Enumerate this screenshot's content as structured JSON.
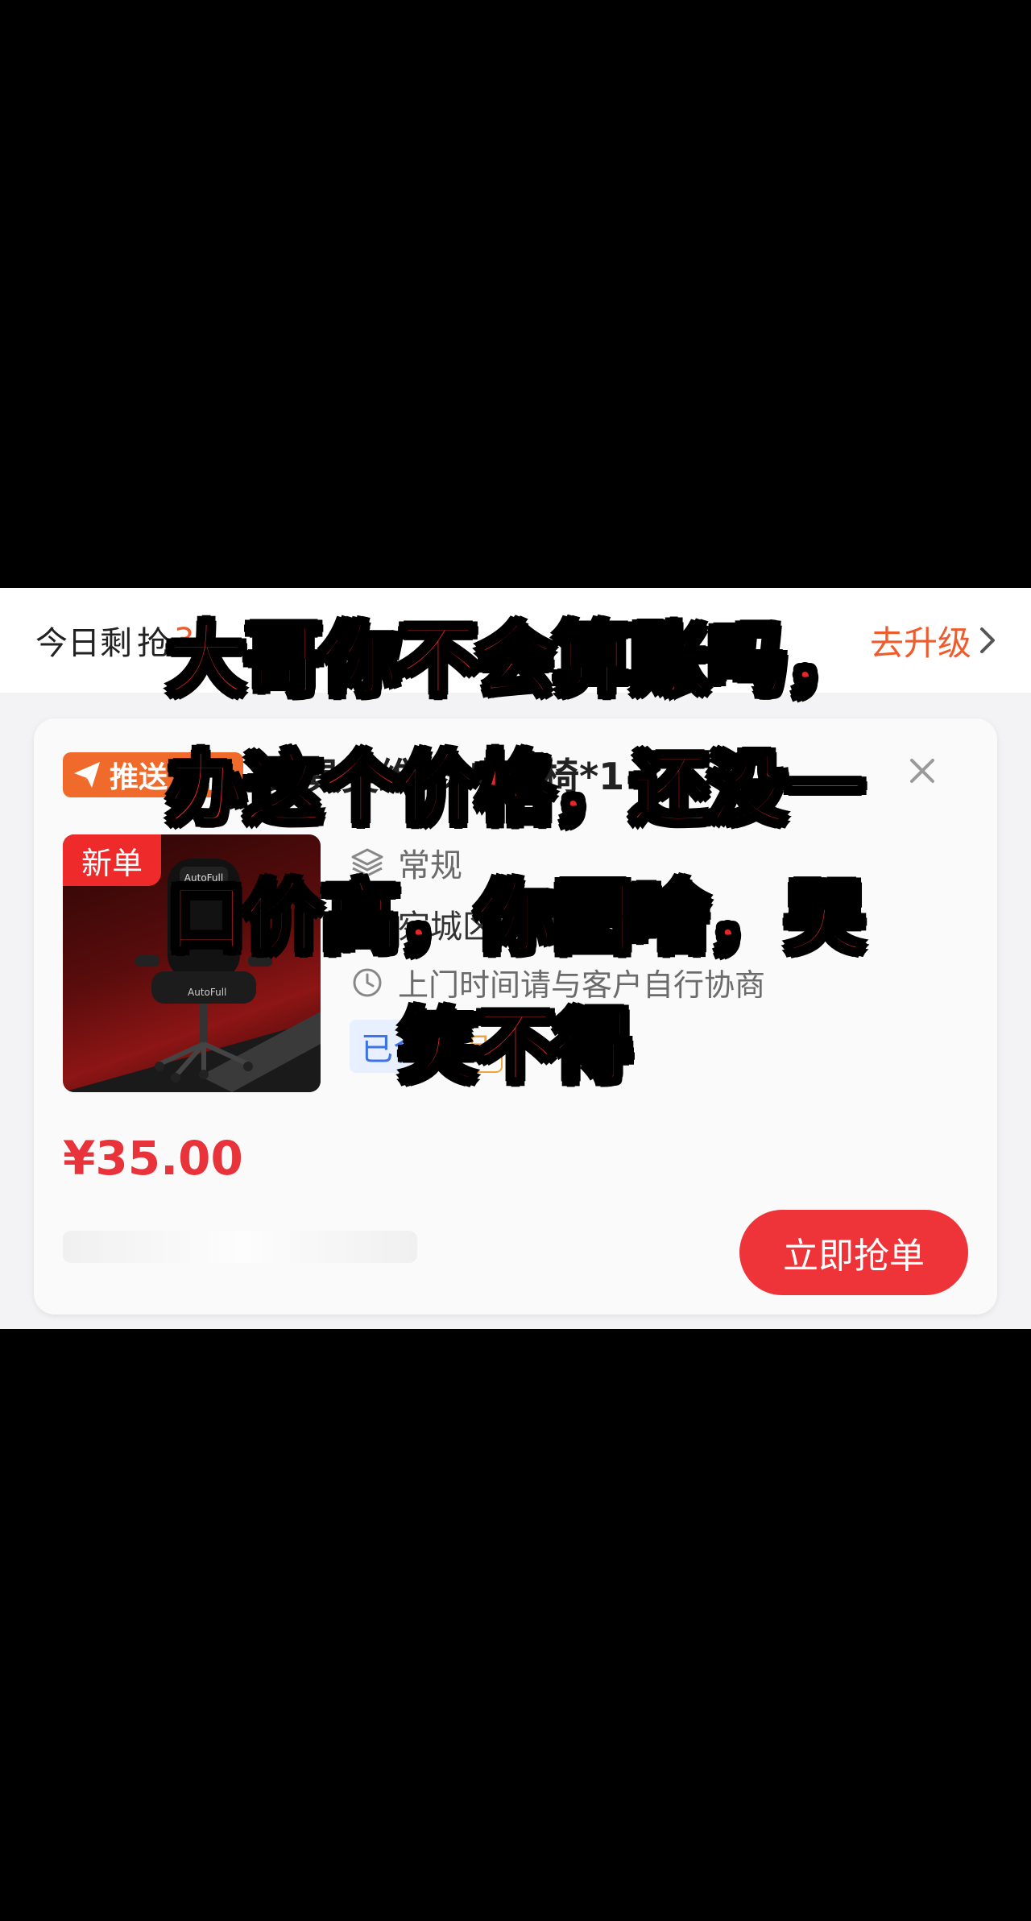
{
  "topbar": {
    "left_prefix": "今日剩",
    "left_middle": "抢",
    "left_count": "3",
    "right_link": "去升级"
  },
  "card": {
    "push_tag": "推送订单",
    "title": "家具类维修-电竞椅*1",
    "type_label": "常规",
    "address": "宛城区                     南阳市",
    "time_note": "上门时间请与客户自行协商",
    "tag_blue": "已合",
    "tag_orange": "保",
    "new_badge": "新单",
    "chair_brand": "AutoFull",
    "price": "¥35.00",
    "grab_button": "立即抢单"
  },
  "overlay": {
    "line1": "大哥你不会算账吗，",
    "line2": "办这个价格，还没一",
    "line3": "口价高，你图啥，哭",
    "line4": "笑不得"
  },
  "colors": {
    "accent_orange": "#ef5b2c",
    "price_red": "#e8333a",
    "button_red": "#ee3438",
    "overlay_red": "#e8242a"
  },
  "icons": [
    "send-icon",
    "close-icon",
    "layers-icon",
    "location-icon",
    "clock-icon",
    "chevron-right-icon"
  ]
}
